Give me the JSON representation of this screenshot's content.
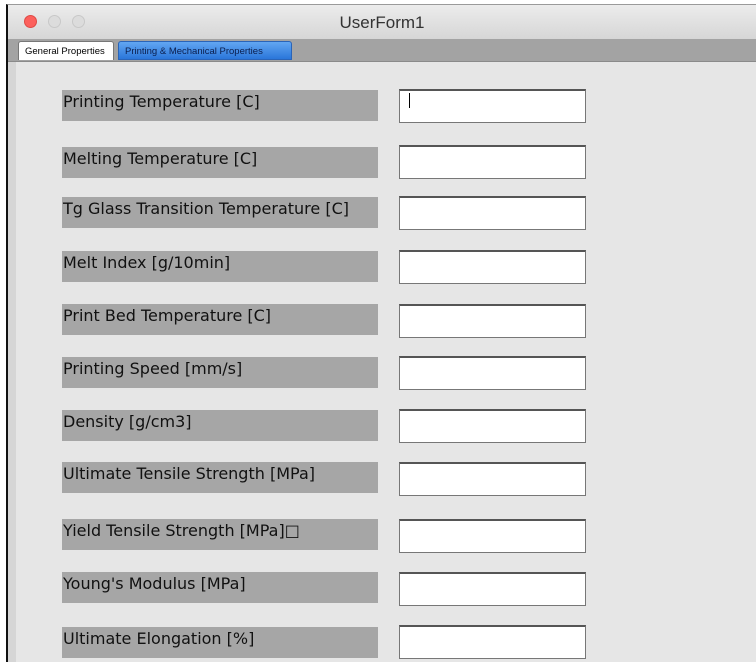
{
  "window": {
    "title": "UserForm1"
  },
  "tabs": [
    {
      "label": "General Properties"
    },
    {
      "label": "Printing & Mechanical Properties"
    }
  ],
  "fields": [
    {
      "label": "Printing Temperature [C]",
      "value": ""
    },
    {
      "label": "Melting Temperature [C]",
      "value": ""
    },
    {
      "label": "Tg Glass Transition Temperature [C]",
      "value": ""
    },
    {
      "label": "Melt Index [g/10min]",
      "value": ""
    },
    {
      "label": "Print Bed Temperature [C]",
      "value": ""
    },
    {
      "label": "Printing Speed [mm/s]",
      "value": ""
    },
    {
      "label": "Density [g/cm3]",
      "value": ""
    },
    {
      "label": "Ultimate Tensile Strength [MPa]",
      "value": ""
    },
    {
      "label": "Yield Tensile Strength [MPa]□",
      "value": ""
    },
    {
      "label": "Young's Modulus [MPa]",
      "value": ""
    },
    {
      "label": "Ultimate Elongation [%]",
      "value": ""
    }
  ],
  "colors": {
    "close_button": "#fc605c",
    "active_tab": "#3d8be8",
    "label_background": "#a6a6a6"
  }
}
